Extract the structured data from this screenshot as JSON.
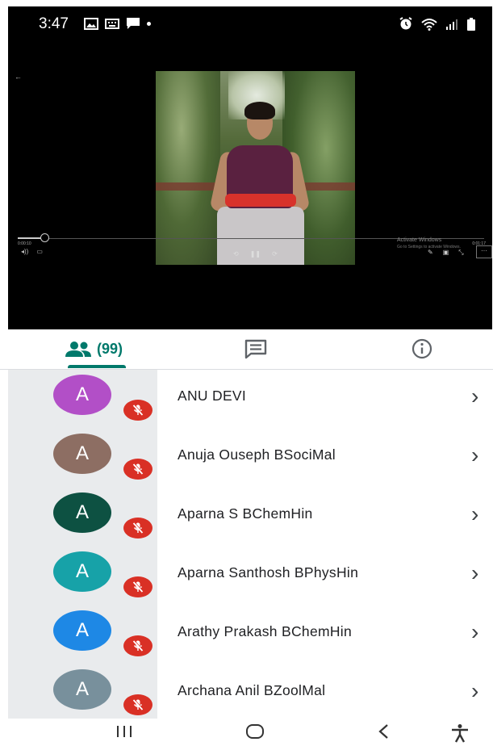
{
  "status_bar": {
    "time": "3:47",
    "left_icons": [
      "gallery-icon",
      "keyboard-icon",
      "message-icon",
      "dot-icon"
    ],
    "right_icons": [
      "alarm-icon",
      "wifi-icon",
      "signal-icon",
      "battery-icon"
    ]
  },
  "video": {
    "time_elapsed": "0:00:10",
    "time_total": "0:01:17",
    "watermark_title": "Activate Windows",
    "watermark_sub": "Go to Settings to activate Windows."
  },
  "tabs": {
    "people_count": "(99)",
    "active": "people"
  },
  "participants": [
    {
      "initial": "A",
      "name": "ANU DEVI",
      "avatar_color": "#b24fc7"
    },
    {
      "initial": "A",
      "name": "Anuja Ouseph BSociMal",
      "avatar_color": "#8d6e63"
    },
    {
      "initial": "A",
      "name": "Aparna S BChemHin",
      "avatar_color": "#0d5142"
    },
    {
      "initial": "A",
      "name": "Aparna Santhosh BPhysHin",
      "avatar_color": "#17a2a8"
    },
    {
      "initial": "A",
      "name": "Arathy Prakash BChemHin",
      "avatar_color": "#1e88e5"
    },
    {
      "initial": "A",
      "name": "Archana Anil BZoolMal",
      "avatar_color": "#78909c"
    }
  ],
  "colors": {
    "accent": "#00796b",
    "mic_off": "#d93025"
  },
  "navbar": {
    "icons": [
      "recents-icon",
      "home-icon",
      "back-icon",
      "accessibility-icon"
    ]
  }
}
